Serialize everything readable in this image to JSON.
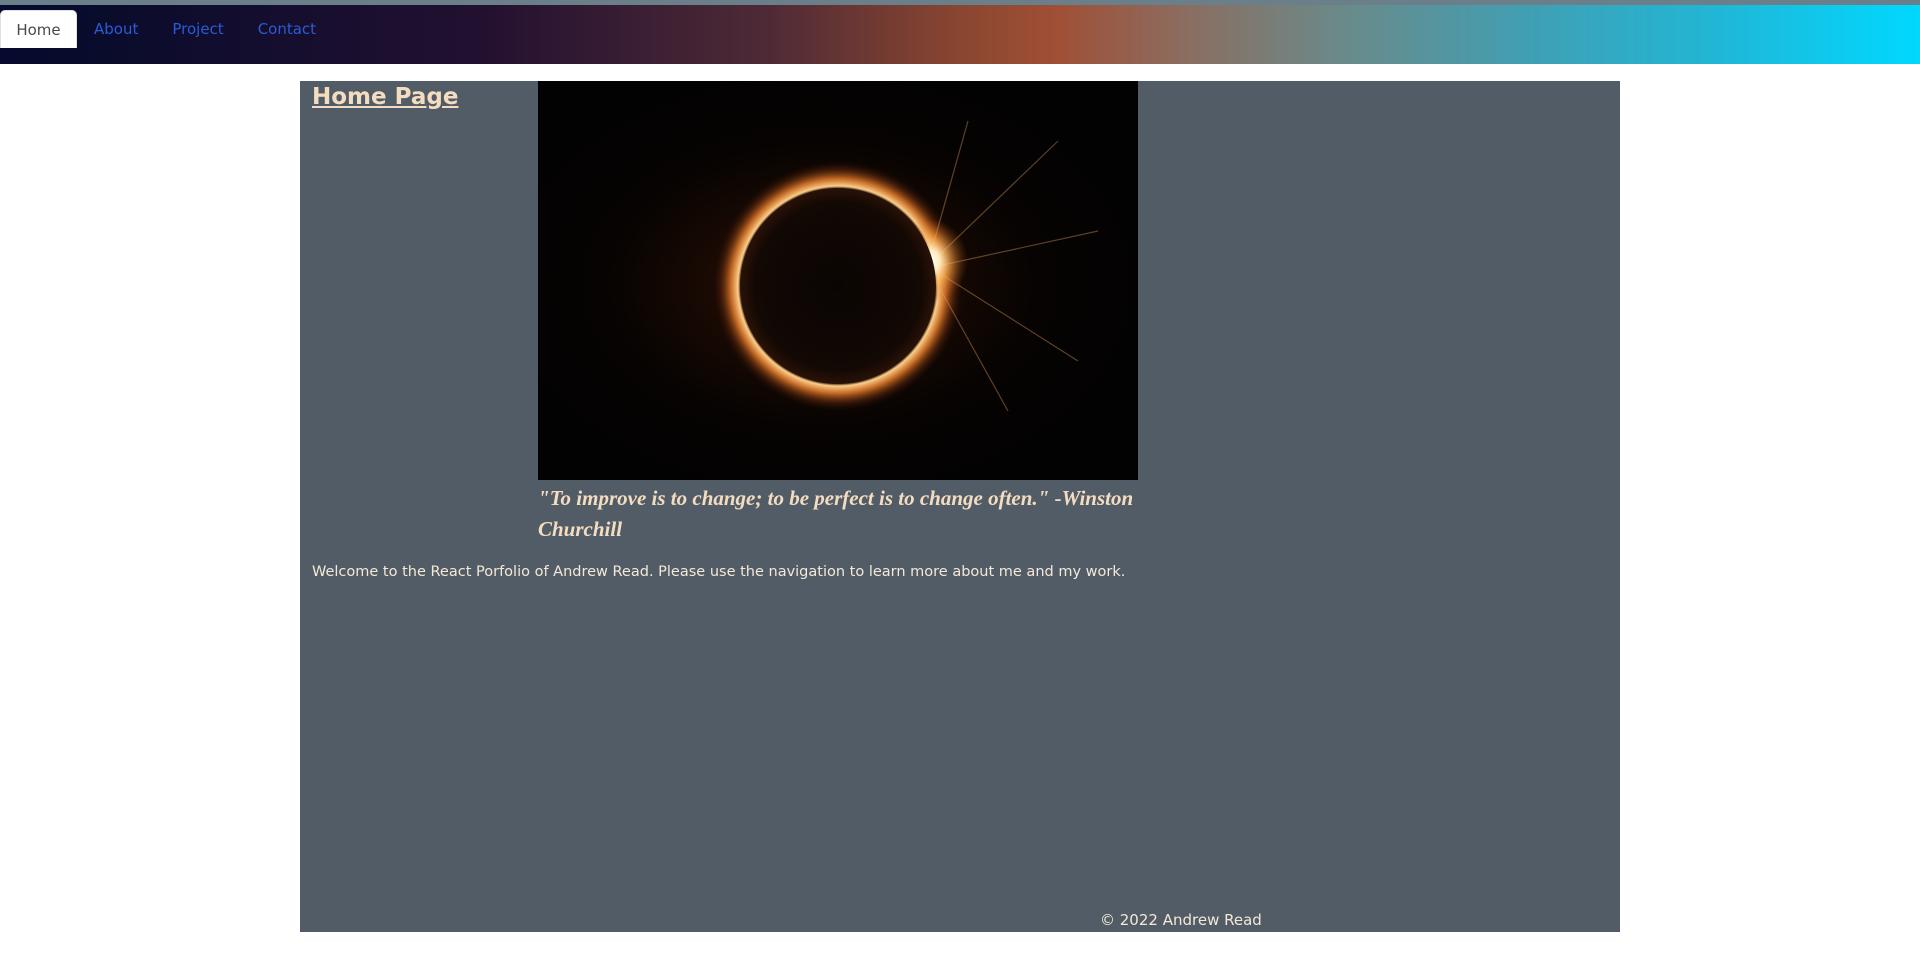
{
  "nav": {
    "items": [
      {
        "label": "Home",
        "active": true
      },
      {
        "label": "About",
        "active": false
      },
      {
        "label": "Project",
        "active": false
      },
      {
        "label": "Contact",
        "active": false
      }
    ]
  },
  "main": {
    "title": "Home Page",
    "quote": "\"To improve is to change; to be perfect is to change often.\" -Winston Churchill",
    "welcome": "Welcome to the React Porfolio of Andrew Read. Please use the navigation to learn more about me and my work."
  },
  "footer": {
    "copyright": "© 2022 Andrew Read"
  },
  "colors": {
    "panel": "#515c66",
    "accent_text": "#f4dcc0",
    "nav_link": "#2b5bd7"
  }
}
